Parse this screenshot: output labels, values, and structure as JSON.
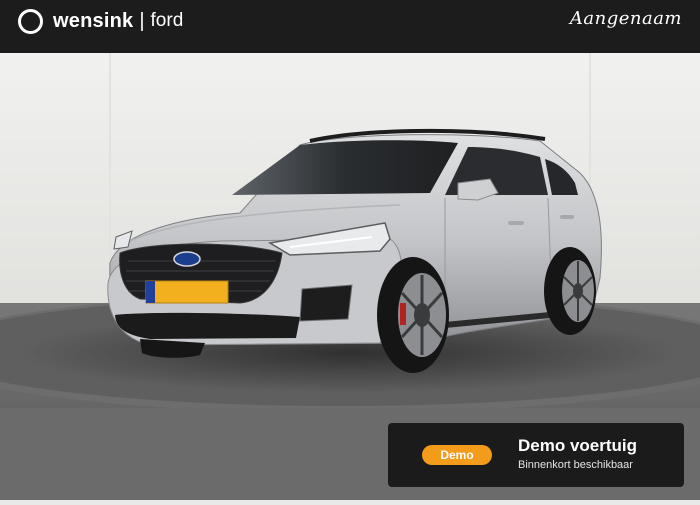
{
  "header": {
    "brand": "wensink",
    "separator": "|",
    "sub_brand": "ford",
    "tagline": "Aangenaam"
  },
  "vehicle_photo": {
    "plate_color": "#f2b01e",
    "body_color": "#c9cbcd"
  },
  "badge": {
    "pill_label": "Demo",
    "title": "Demo voertuig",
    "subtitle": "Binnenkort beschikbaar",
    "accent_color": "#f39c1b"
  }
}
